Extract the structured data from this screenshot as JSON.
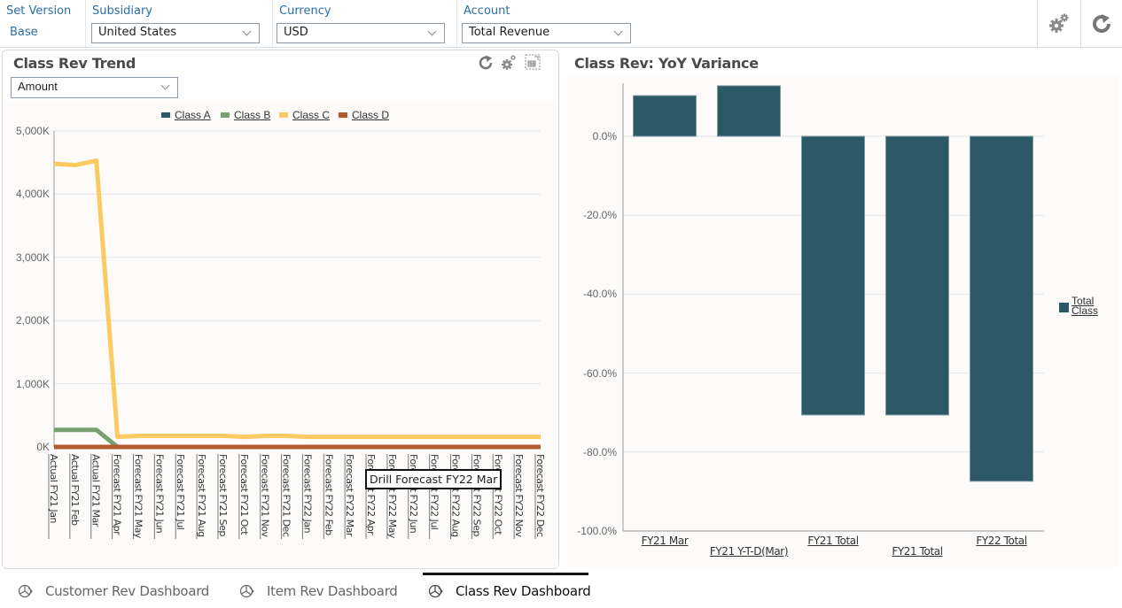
{
  "filters": {
    "set_version": {
      "label": "Set Version",
      "value": "Base"
    },
    "subsidiary": {
      "label": "Subsidiary",
      "value": "United States"
    },
    "currency": {
      "label": "Currency",
      "value": "USD"
    },
    "account": {
      "label": "Account",
      "value": "Total Revenue"
    }
  },
  "toolbar": {
    "settings_icon": "gears-icon",
    "refresh_icon": "refresh-icon"
  },
  "left_panel": {
    "title": "Class Rev Trend",
    "measure_select": "Amount",
    "tooltip": "Drill Forecast FY22 Mar"
  },
  "right_panel": {
    "title": "Class Rev: YoY Variance"
  },
  "tabs": [
    {
      "label": "Customer Rev Dashboard",
      "active": false
    },
    {
      "label": "Item Rev Dashboard",
      "active": false
    },
    {
      "label": "Class Rev Dashboard",
      "active": true
    }
  ],
  "chart_data": [
    {
      "type": "line",
      "title": "Class Rev Trend",
      "xlabel": "",
      "ylabel": "",
      "ylim": [
        0,
        5000
      ],
      "y_unit": "K",
      "yticks": [
        "0K",
        "1,000K",
        "2,000K",
        "3,000K",
        "4,000K",
        "5,000K"
      ],
      "grid": true,
      "legend": "top-center",
      "categories": [
        "Actual FY21 Jan",
        "Actual FY21 Feb",
        "Actual FY21 Mar",
        "Forecast FY21 Apr",
        "Forecast FY21 May",
        "Forecast FY21 Jun",
        "Forecast FY21 Jul",
        "Forecast FY21 Aug",
        "Forecast FY21 Sep",
        "Forecast FY21 Oct",
        "Forecast FY21 Nov",
        "Forecast FY21 Dec",
        "Forecast FY22 Jan",
        "Forecast FY22 Feb",
        "Forecast FY22 Mar",
        "Forecast FY22 Apr",
        "Forecast FY22 May",
        "Forecast FY22 Jun",
        "Forecast FY22 Jul",
        "Forecast FY22 Aug",
        "Forecast FY22 Sep",
        "Forecast FY22 Oct",
        "Forecast FY22 Nov",
        "Forecast FY22 Dec"
      ],
      "series": [
        {
          "name": "Class A",
          "color": "#2d5967",
          "values": [
            0,
            0,
            0,
            0,
            0,
            0,
            0,
            0,
            0,
            0,
            0,
            0,
            0,
            0,
            0,
            0,
            0,
            0,
            0,
            0,
            0,
            0,
            0,
            0
          ]
        },
        {
          "name": "Class B",
          "color": "#76a06e",
          "values": [
            270,
            270,
            270,
            0,
            0,
            0,
            0,
            0,
            0,
            0,
            0,
            0,
            0,
            0,
            0,
            0,
            0,
            0,
            0,
            0,
            0,
            0,
            0,
            0
          ]
        },
        {
          "name": "Class C",
          "color": "#fbcb62",
          "values": [
            4480,
            4460,
            4530,
            160,
            175,
            175,
            175,
            175,
            175,
            160,
            175,
            175,
            160,
            160,
            160,
            160,
            160,
            160,
            160,
            160,
            160,
            160,
            160,
            160
          ]
        },
        {
          "name": "Class D",
          "color": "#b05a2d",
          "values": [
            0,
            0,
            0,
            0,
            0,
            0,
            0,
            0,
            0,
            0,
            0,
            0,
            0,
            0,
            0,
            0,
            0,
            0,
            0,
            0,
            0,
            0,
            0,
            0
          ]
        }
      ]
    },
    {
      "type": "bar",
      "title": "Class Rev: YoY Variance",
      "xlabel": "",
      "ylabel": "",
      "ylim": [
        -100,
        12.8
      ],
      "yticks": [
        "0.0%",
        "-20.0%",
        "-40.0%",
        "-60.0%",
        "-80.0%",
        "-100.0%"
      ],
      "grid": true,
      "legend": "right",
      "categories": [
        "FY21 Mar",
        "FY21 Y-T-D(Mar)",
        "FY21 Total",
        "FY21 Total",
        "FY22 Total"
      ],
      "series": [
        {
          "name": "Total Class",
          "color": "#2d5967",
          "values": [
            10.3,
            12.8,
            -70.6,
            -70.6,
            -87.4
          ]
        }
      ]
    }
  ]
}
